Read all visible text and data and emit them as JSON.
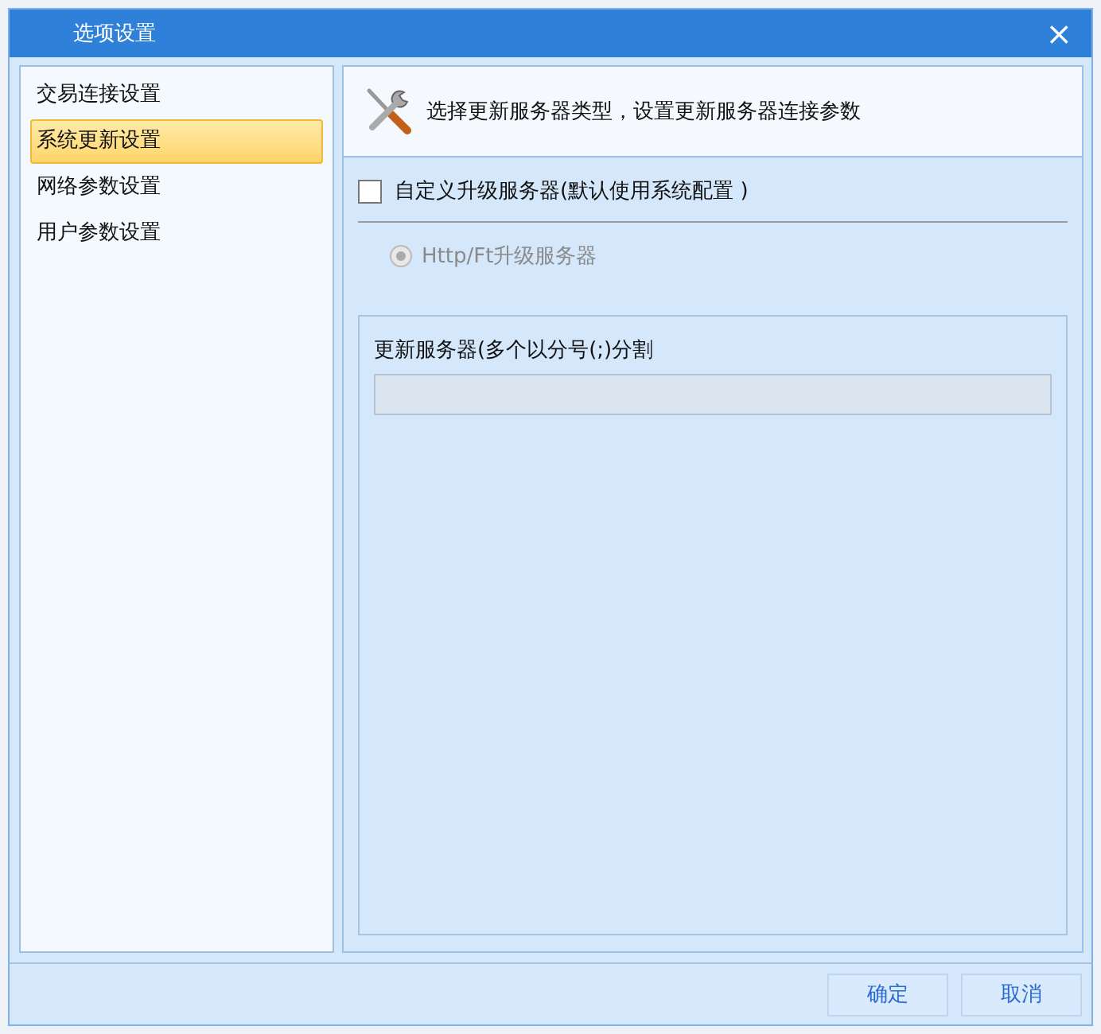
{
  "window": {
    "title": "选项设置",
    "close": "×"
  },
  "sidebar": {
    "items": [
      {
        "label": "交易连接设置",
        "selected": false
      },
      {
        "label": "系统更新设置",
        "selected": true
      },
      {
        "label": "网络参数设置",
        "selected": false
      },
      {
        "label": "用户参数设置",
        "selected": false
      }
    ]
  },
  "header": {
    "text": "选择更新服务器类型，设置更新服务器连接参数"
  },
  "custom_server": {
    "label": "自定义升级服务器(默认使用系统配置 )",
    "checked": false
  },
  "server_type": {
    "label": "Http/Ft升级服务器",
    "selected": true,
    "disabled": true
  },
  "server_group": {
    "label": "更新服务器(多个以分号(;)分割"
  },
  "buttons": [
    {
      "label": "确定"
    },
    {
      "label": "取消"
    }
  ]
}
